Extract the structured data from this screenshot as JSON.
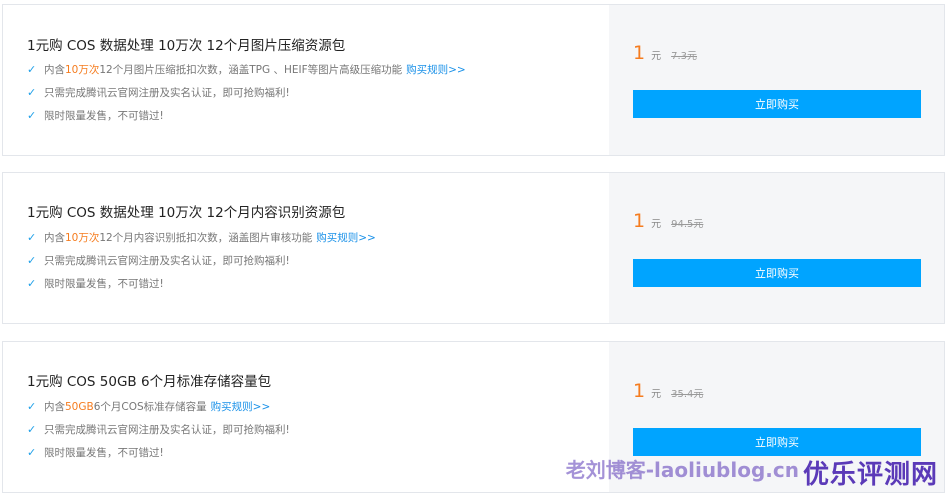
{
  "cards": [
    {
      "title": "1元购 COS 数据处理  10万次 12个月图片压缩资源包",
      "feature1_prefix": "内含 ",
      "feature1_highlight": "10万次",
      "feature1_suffix": " 12个月图片压缩抵扣次数，涵盖TPG 、HEIF等图片高级压缩功能",
      "feature1_link": "购买规则>>",
      "feature2": "只需完成腾讯云官网注册及实名认证，即可抢购福利!",
      "feature3": "限时限量发售，不可错过!",
      "price": "1",
      "unit": "元",
      "original_price": "7.3元",
      "button": "立即购买"
    },
    {
      "title": "1元购 COS 数据处理 10万次 12个月内容识别资源包",
      "feature1_prefix": "内含 ",
      "feature1_highlight": "10万次",
      "feature1_suffix": " 12个月内容识别抵扣次数，涵盖图片审核功能",
      "feature1_link": "购买规则>>",
      "feature2": "只需完成腾讯云官网注册及实名认证，即可抢购福利!",
      "feature3": "限时限量发售，不可错过!",
      "price": "1",
      "unit": "元",
      "original_price": "94.5元",
      "button": "立即购买"
    },
    {
      "title": "1元购 COS 50GB 6个月标准存储容量包",
      "feature1_prefix": "内含 ",
      "feature1_highlight": "50GB",
      "feature1_suffix": " 6个月COS标准存储容量",
      "feature1_link": "购买规则>>",
      "feature2": "只需完成腾讯云官网注册及实名认证，即可抢购福利!",
      "feature3": "限时限量发售，不可错过!",
      "price": "1",
      "unit": "元",
      "original_price": "35.4元",
      "button": "立即购买"
    }
  ],
  "watermark": {
    "small": "老刘博客-laoliublog.cn",
    "big": "优乐评测网"
  },
  "icons": {
    "check": "check-icon"
  },
  "colors": {
    "accent": "#00a4ff",
    "highlight": "#f57c1f",
    "link": "#1a91e8"
  }
}
